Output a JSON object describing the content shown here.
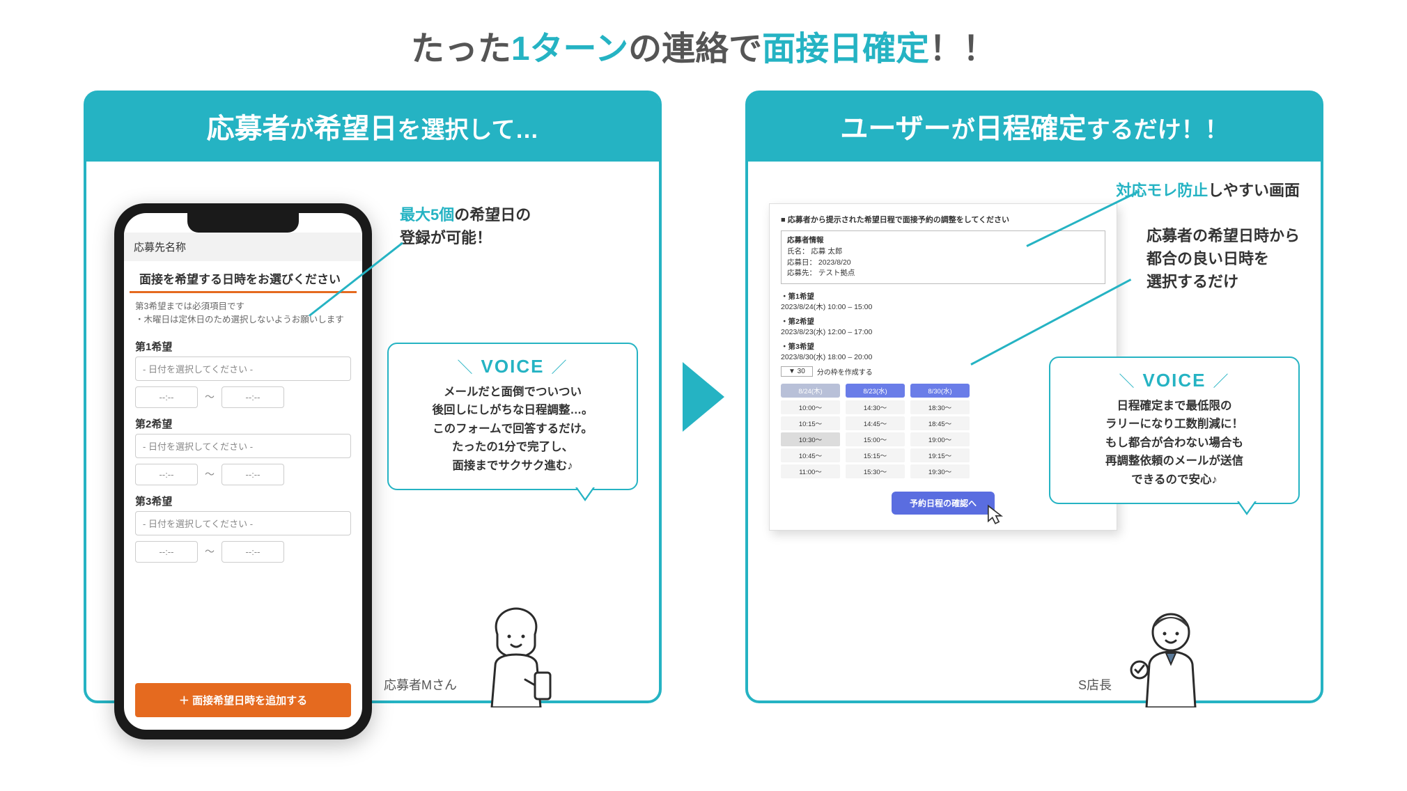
{
  "title": {
    "p1": "たった",
    "p2": "1ターン",
    "p3": "の連絡で",
    "p4": "面接日確定",
    "p5": "！！"
  },
  "left": {
    "header_a": "応募者",
    "header_b": "が",
    "header_c": "希望日",
    "header_d": "を選択して…",
    "phone": {
      "tag": "応募先名称",
      "heading": "面接を希望する日時をお選びください",
      "note": "第3希望までは必須項目です\n・木曜日は定休日のため選択しないようお願いします",
      "prefs": [
        {
          "label": "第1希望",
          "date_placeholder": "- 日付を選択してください -",
          "tt": "--:--"
        },
        {
          "label": "第2希望",
          "date_placeholder": "- 日付を選択してください -",
          "tt": "--:--"
        },
        {
          "label": "第3希望",
          "date_placeholder": "- 日付を選択してください -",
          "tt": "--:--"
        }
      ],
      "add_btn": "＋ 面接希望日時を追加する"
    },
    "annotation": {
      "accent": "最大5個",
      "rest": "の希望日の\n登録が可能！"
    },
    "voice": {
      "title": "VOICE",
      "text": "メールだと面倒でついつい\n後回しにしがちな日程調整…。\nこのフォームで回答するだけ。\nたったの1分で完了し、\n面接までサクサク進む♪"
    },
    "persona": "応募者Mさん"
  },
  "right": {
    "header_a": "ユーザー",
    "header_b": "が",
    "header_c": "日程確定",
    "header_d": "するだけ！！",
    "desk": {
      "title": "■ 応募者から提示された希望日程で面接予約の調整をしてください",
      "info_label": "応募者情報",
      "info_name": "氏名： 応募 太郎",
      "info_date": "応募日： 2023/8/20",
      "info_loc": "応募先： テスト拠点",
      "prefs": [
        {
          "t": "・第1希望",
          "v": "2023/8/24(木) 10:00 – 15:00"
        },
        {
          "t": "・第2希望",
          "v": "2023/8/23(水) 12:00 – 17:00"
        },
        {
          "t": "・第3希望",
          "v": "2023/8/30(水) 18:00 – 20:00"
        }
      ],
      "duration_sel": "▼ 30",
      "duration_txt": "分の枠を作成する",
      "cols": [
        {
          "h": "8/24(木)",
          "grey": true,
          "slots": [
            "10:00〜",
            "10:15〜",
            "10:30〜",
            "10:45〜",
            "11:00〜"
          ],
          "sel": 2
        },
        {
          "h": "8/23(水)",
          "grey": false,
          "slots": [
            "14:30〜",
            "14:45〜",
            "15:00〜",
            "15:15〜",
            "15:30〜"
          ],
          "sel": -1
        },
        {
          "h": "8/30(水)",
          "grey": false,
          "slots": [
            "18:30〜",
            "18:45〜",
            "19:00〜",
            "19:15〜",
            "19:30〜"
          ],
          "sel": -1
        }
      ],
      "confirm": "予約日程の確認へ"
    },
    "ann1": {
      "accent": "対応モレ防止",
      "rest": "しやすい画面"
    },
    "ann2": "応募者の希望日時から\n都合の良い日時を\n選択するだけ",
    "voice": {
      "title": "VOICE",
      "text": "日程確定まで最低限の\nラリーになり工数削減に！\nもし都合が合わない場合も\n再調整依頼のメールが送信\nできるので安心♪"
    },
    "persona": "S店長"
  }
}
